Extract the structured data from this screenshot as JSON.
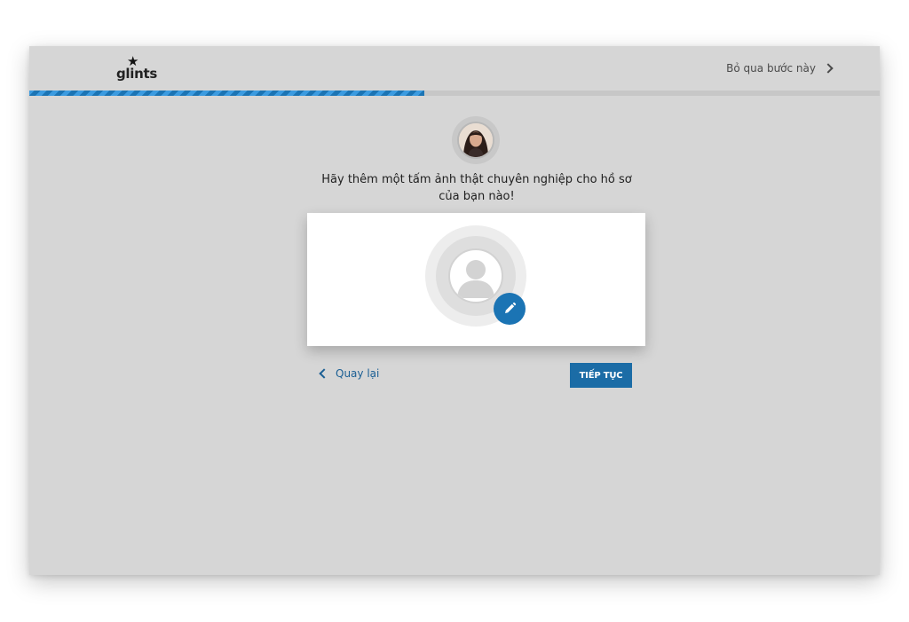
{
  "header": {
    "logo_text": "glints",
    "skip_label": "Bỏ qua bước này"
  },
  "progress": {
    "value": 0.465
  },
  "main": {
    "heading_line1": "Hãy thêm một tấm ảnh thật chuyên nghiệp cho hồ sơ",
    "heading_line2": "của bạn nào!"
  },
  "actions": {
    "back_label": "Quay lại",
    "continue_label": "TIẾP TỤC"
  },
  "icons": {
    "logo": "star-icon",
    "skip": "chevron-right-icon",
    "back": "chevron-left-icon",
    "edit": "pencil-icon",
    "placeholder": "user-silhouette-icon"
  },
  "colors": {
    "accent": "#1b74b4",
    "background": "#d6d6d6",
    "card": "#ffffff"
  }
}
